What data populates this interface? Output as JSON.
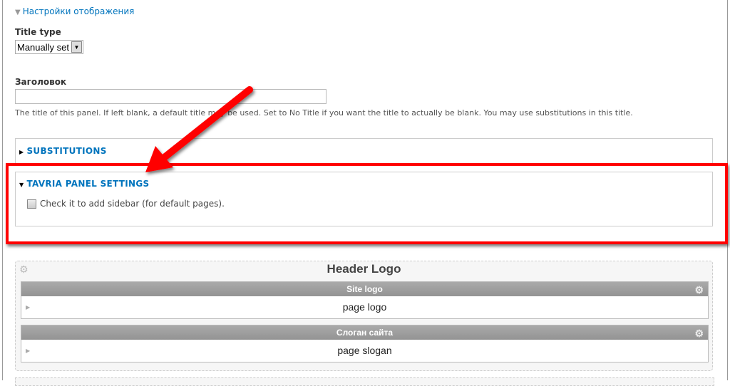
{
  "display_settings": {
    "legend": "Настройки отображения",
    "toggle_icon": "triangle-down-icon"
  },
  "title_type": {
    "label": "Title type",
    "selected": "Manually set"
  },
  "heading": {
    "label": "Заголовок",
    "value": "",
    "description": "The title of this panel. If left blank, a default title may be used. Set to No Title if you want the title to actually be blank. You may use substitutions in this title."
  },
  "substitutions": {
    "title": "SUBSTITUTIONS",
    "collapsed": true
  },
  "tavria": {
    "title": "TAVRIA PANEL SETTINGS",
    "checkbox_label": "Check it to add sidebar (for default pages).",
    "checked": false
  },
  "annotation": {
    "color": "#ff0000"
  },
  "region": {
    "title": "Header Logo",
    "panes": [
      {
        "title": "Site logo",
        "content": "page logo"
      },
      {
        "title": "Слоган сайта",
        "content": "page slogan"
      }
    ]
  },
  "colors": {
    "link": "#0074bd",
    "pane_header": "#9e9e9e"
  }
}
